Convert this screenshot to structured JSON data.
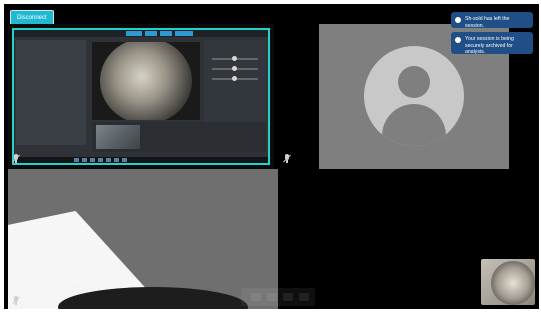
{
  "header": {
    "disconnect_label": "Disconnect"
  },
  "notifications": [
    {
      "text": "Sh-sold has left the session."
    },
    {
      "text": "Your session is being securely archived for analysis."
    }
  ],
  "tiles": {
    "top_left": {
      "content": "shared-screen"
    },
    "top_right": {
      "content": "avatar-placeholder"
    },
    "bottom_left": {
      "content": "camera-feed"
    },
    "bottom_right": {
      "content": "empty"
    }
  },
  "icons": [
    "muted-mic-icon",
    "avatar-placeholder-icon"
  ]
}
